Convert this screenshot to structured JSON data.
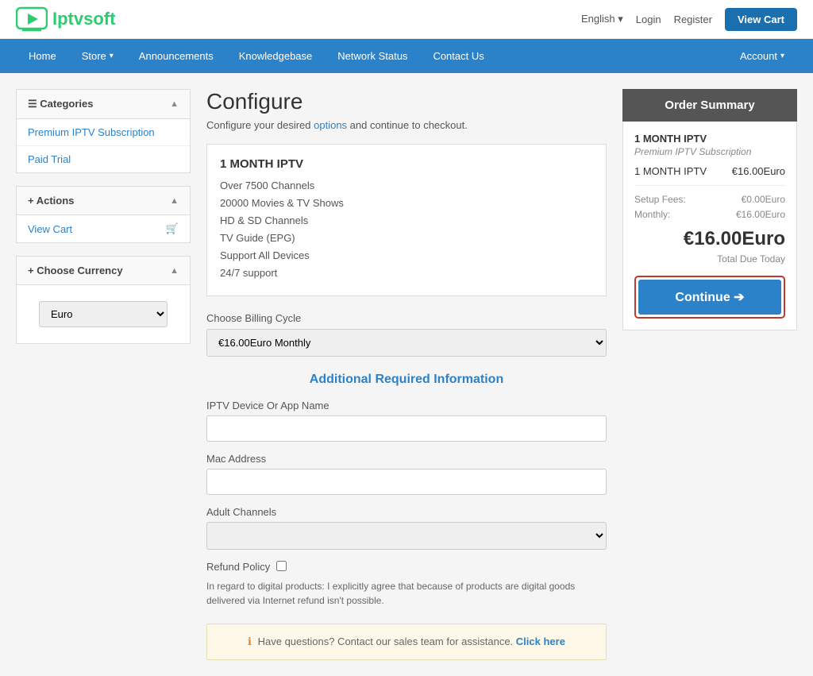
{
  "brand": {
    "name": "Iptvsoft",
    "logo_alt": "Iptvsoft logo"
  },
  "topbar": {
    "language": "English",
    "login_label": "Login",
    "register_label": "Register",
    "view_cart_label": "View Cart"
  },
  "nav": {
    "items": [
      {
        "label": "Home"
      },
      {
        "label": "Store",
        "has_dropdown": true
      },
      {
        "label": "Announcements"
      },
      {
        "label": "Knowledgebase"
      },
      {
        "label": "Network Status"
      },
      {
        "label": "Contact Us"
      }
    ],
    "account_label": "Account"
  },
  "sidebar": {
    "categories_header": "Categories",
    "categories_items": [
      {
        "label": "Premium IPTV Subscription"
      },
      {
        "label": "Paid Trial"
      }
    ],
    "actions_header": "Actions",
    "view_cart_label": "View Cart",
    "currency_header": "Choose Currency",
    "currency_option": "Euro"
  },
  "page": {
    "title": "Configure",
    "subtitle": "Configure your desired options and continue to checkout.",
    "subtitle_link": "options"
  },
  "product": {
    "name": "1 MONTH IPTV",
    "features": [
      "Over 7500 Channels",
      "20000 Movies & TV Shows",
      "HD & SD Channels",
      "TV Guide (EPG)",
      "Support All Devices",
      "24/7 support"
    ]
  },
  "billing": {
    "label": "Choose Billing Cycle",
    "option": "€16.00Euro Monthly"
  },
  "additional_info": {
    "title": "Additional Required Information",
    "fields": [
      {
        "label": "IPTV Device Or App Name",
        "type": "text",
        "placeholder": ""
      },
      {
        "label": "Mac Address",
        "type": "text",
        "placeholder": ""
      },
      {
        "label": "Adult Channels",
        "type": "select",
        "placeholder": ""
      }
    ]
  },
  "refund": {
    "label": "Refund Policy",
    "text": "In regard to digital products: I explicitly agree that because of products are digital goods delivered via Internet refund isn't possible."
  },
  "help": {
    "text": "Have questions? Contact our sales team for assistance.",
    "link_label": "Click here"
  },
  "order_summary": {
    "header": "Order Summary",
    "product_name": "1 MONTH IPTV",
    "product_sub": "Premium IPTV Subscription",
    "line1_label": "1 MONTH IPTV",
    "line1_value": "€16.00Euro",
    "setup_label": "Setup Fees:",
    "setup_value": "€0.00Euro",
    "monthly_label": "Monthly:",
    "monthly_value": "€16.00Euro",
    "total": "€16.00Euro",
    "total_label": "Total Due Today",
    "continue_label": "Continue"
  }
}
